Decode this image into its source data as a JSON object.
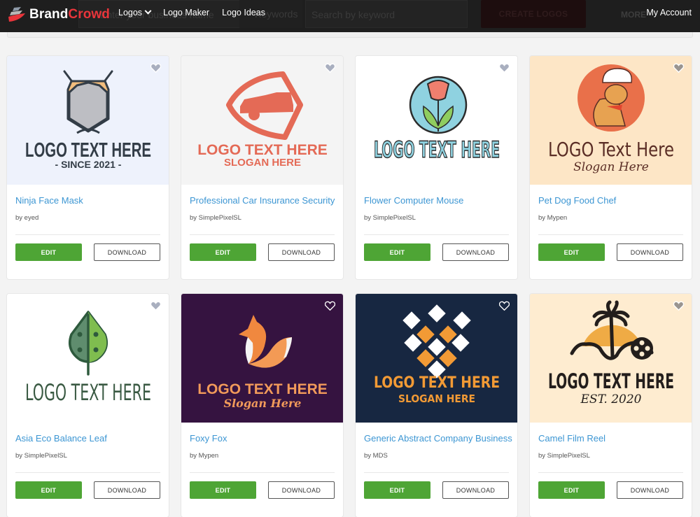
{
  "header": {
    "brand_part1": "Brand",
    "brand_part2": "Crowd",
    "nav": [
      {
        "label": "Logos",
        "has_dropdown": true
      },
      {
        "label": "Logo Maker"
      },
      {
        "label": "Logo Ideas"
      }
    ],
    "ghost_business_placeholder": "Enter your business name",
    "ghost_keywords_label": "Keywords",
    "ghost_search_placeholder": "Search by keyword",
    "ghost_create_label": "CREATE LOGOS",
    "ghost_more_label": "MORE",
    "account_label": "My Account"
  },
  "buttons": {
    "edit": "EDIT",
    "download": "DOWNLOAD"
  },
  "cards": [
    {
      "title": "Ninja Face Mask",
      "author": "by eyed",
      "bg": "#eef2fc",
      "heart": "#a9afbf",
      "logo_text": "LOGO TEXT HERE",
      "slogan": "- SINCE 2021 -",
      "text_color": "#333d47"
    },
    {
      "title": "Professional Car Insurance Security",
      "author": "by SimplePixelSL",
      "bg": "#f4f4f4",
      "heart": "#a9afbf",
      "logo_text": "LOGO TEXT HERE",
      "slogan": "SLOGAN HERE",
      "text_color": "#e46a56"
    },
    {
      "title": "Flower Computer Mouse",
      "author": "by SimplePixelSL",
      "bg": "#ffffff",
      "heart": "#a9afbf",
      "logo_text": "LOGO TEXT HERE",
      "slogan": "",
      "text_color": "#8fd2e0"
    },
    {
      "title": "Pet Dog Food Chef",
      "author": "by Mypen",
      "bg": "#fde6c6",
      "heart": "#9a9590",
      "logo_text": "LOGO Text Here",
      "slogan": "Slogan Here",
      "text_color": "#5a2d25"
    },
    {
      "title": "Asia Eco Balance Leaf",
      "author": "by SimplePixelSL",
      "bg": "#ffffff",
      "heart": "#a9afbf",
      "logo_text": "LOGO TEXT HERE",
      "slogan": "",
      "text_color": "#3a5a43"
    },
    {
      "title": "Foxy Fox",
      "author": "by Mypen",
      "bg": "#351340",
      "heart": "#ffffff",
      "logo_text": "LOGO TEXT HERE",
      "slogan": "Slogan Here",
      "text_color": "#f19a5a"
    },
    {
      "title": "Generic Abstract Company Business",
      "author": "by MDS",
      "bg": "#172741",
      "heart": "#ffffff",
      "logo_text": "LOGO TEXT HERE",
      "slogan": "SLOGAN HERE",
      "text_color": "#f29a35"
    },
    {
      "title": "Camel Film Reel",
      "author": "by SimplePixelSL",
      "bg": "#feecd0",
      "heart": "#9a9590",
      "logo_text": "LOGO TEXT HERE",
      "slogan": "EST. 2020",
      "text_color": "#231e1c"
    }
  ]
}
